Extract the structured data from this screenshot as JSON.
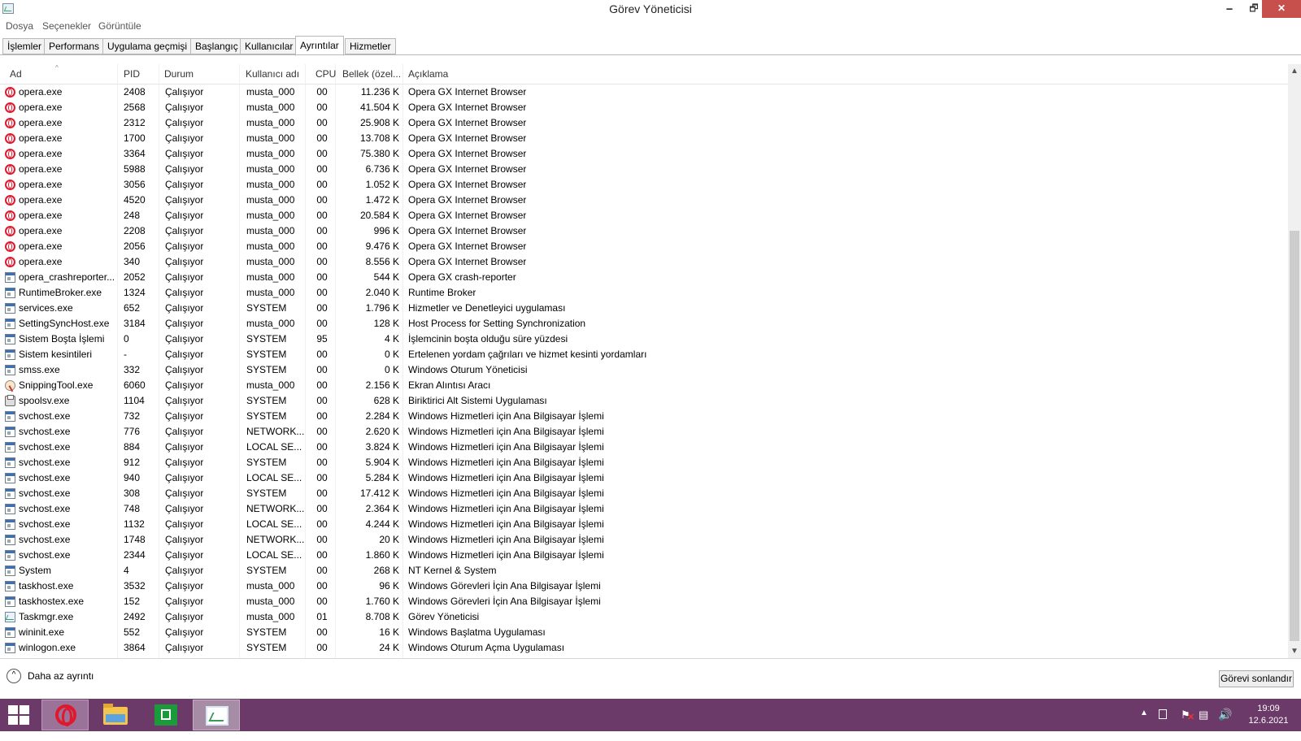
{
  "window": {
    "title": "Görev Yöneticisi",
    "min_glyph": "🗕",
    "max_glyph": "🗗",
    "close_glyph": "✕"
  },
  "menu": [
    "Dosya",
    "Seçenekler",
    "Görüntüle"
  ],
  "tabs": [
    {
      "label": "İşlemler",
      "active": false
    },
    {
      "label": "Performans",
      "active": false
    },
    {
      "label": "Uygulama geçmişi",
      "active": false
    },
    {
      "label": "Başlangıç",
      "active": false
    },
    {
      "label": "Kullanıcılar",
      "active": false
    },
    {
      "label": "Ayrıntılar",
      "active": true
    },
    {
      "label": "Hizmetler",
      "active": false
    }
  ],
  "columns": {
    "name": "Ad",
    "pid": "PID",
    "status": "Durum",
    "user": "Kullanıcı adı",
    "cpu": "CPU",
    "memory": "Bellek (özel...",
    "description": "Açıklama"
  },
  "rows": [
    {
      "icon": "opera",
      "name": "opera.exe",
      "pid": "2408",
      "status": "Çalışıyor",
      "user": "musta_000",
      "cpu": "00",
      "mem": "11.236 K",
      "desc": "Opera GX Internet Browser"
    },
    {
      "icon": "opera",
      "name": "opera.exe",
      "pid": "2568",
      "status": "Çalışıyor",
      "user": "musta_000",
      "cpu": "00",
      "mem": "41.504 K",
      "desc": "Opera GX Internet Browser"
    },
    {
      "icon": "opera",
      "name": "opera.exe",
      "pid": "2312",
      "status": "Çalışıyor",
      "user": "musta_000",
      "cpu": "00",
      "mem": "25.908 K",
      "desc": "Opera GX Internet Browser"
    },
    {
      "icon": "opera",
      "name": "opera.exe",
      "pid": "1700",
      "status": "Çalışıyor",
      "user": "musta_000",
      "cpu": "00",
      "mem": "13.708 K",
      "desc": "Opera GX Internet Browser"
    },
    {
      "icon": "opera",
      "name": "opera.exe",
      "pid": "3364",
      "status": "Çalışıyor",
      "user": "musta_000",
      "cpu": "00",
      "mem": "75.380 K",
      "desc": "Opera GX Internet Browser"
    },
    {
      "icon": "opera",
      "name": "opera.exe",
      "pid": "5988",
      "status": "Çalışıyor",
      "user": "musta_000",
      "cpu": "00",
      "mem": "6.736 K",
      "desc": "Opera GX Internet Browser"
    },
    {
      "icon": "opera",
      "name": "opera.exe",
      "pid": "3056",
      "status": "Çalışıyor",
      "user": "musta_000",
      "cpu": "00",
      "mem": "1.052 K",
      "desc": "Opera GX Internet Browser"
    },
    {
      "icon": "opera",
      "name": "opera.exe",
      "pid": "4520",
      "status": "Çalışıyor",
      "user": "musta_000",
      "cpu": "00",
      "mem": "1.472 K",
      "desc": "Opera GX Internet Browser"
    },
    {
      "icon": "opera",
      "name": "opera.exe",
      "pid": "248",
      "status": "Çalışıyor",
      "user": "musta_000",
      "cpu": "00",
      "mem": "20.584 K",
      "desc": "Opera GX Internet Browser"
    },
    {
      "icon": "opera",
      "name": "opera.exe",
      "pid": "2208",
      "status": "Çalışıyor",
      "user": "musta_000",
      "cpu": "00",
      "mem": "996 K",
      "desc": "Opera GX Internet Browser"
    },
    {
      "icon": "opera",
      "name": "opera.exe",
      "pid": "2056",
      "status": "Çalışıyor",
      "user": "musta_000",
      "cpu": "00",
      "mem": "9.476 K",
      "desc": "Opera GX Internet Browser"
    },
    {
      "icon": "opera",
      "name": "opera.exe",
      "pid": "340",
      "status": "Çalışıyor",
      "user": "musta_000",
      "cpu": "00",
      "mem": "8.556 K",
      "desc": "Opera GX Internet Browser"
    },
    {
      "icon": "exe",
      "name": "opera_crashreporter....",
      "pid": "2052",
      "status": "Çalışıyor",
      "user": "musta_000",
      "cpu": "00",
      "mem": "544 K",
      "desc": "Opera GX crash-reporter"
    },
    {
      "icon": "exe",
      "name": "RuntimeBroker.exe",
      "pid": "1324",
      "status": "Çalışıyor",
      "user": "musta_000",
      "cpu": "00",
      "mem": "2.040 K",
      "desc": "Runtime Broker"
    },
    {
      "icon": "exe",
      "name": "services.exe",
      "pid": "652",
      "status": "Çalışıyor",
      "user": "SYSTEM",
      "cpu": "00",
      "mem": "1.796 K",
      "desc": "Hizmetler ve Denetleyici uygulaması"
    },
    {
      "icon": "exe",
      "name": "SettingSyncHost.exe",
      "pid": "3184",
      "status": "Çalışıyor",
      "user": "musta_000",
      "cpu": "00",
      "mem": "128 K",
      "desc": "Host Process for Setting Synchronization"
    },
    {
      "icon": "exe",
      "name": "Sistem Boşta İşlemi",
      "pid": "0",
      "status": "Çalışıyor",
      "user": "SYSTEM",
      "cpu": "95",
      "mem": "4 K",
      "desc": "İşlemcinin boşta olduğu süre yüzdesi"
    },
    {
      "icon": "exe",
      "name": "Sistem kesintileri",
      "pid": "-",
      "status": "Çalışıyor",
      "user": "SYSTEM",
      "cpu": "00",
      "mem": "0 K",
      "desc": "Ertelenen yordam çağrıları ve hizmet kesinti yordamları"
    },
    {
      "icon": "exe",
      "name": "smss.exe",
      "pid": "332",
      "status": "Çalışıyor",
      "user": "SYSTEM",
      "cpu": "00",
      "mem": "0 K",
      "desc": "Windows Oturum Yöneticisi"
    },
    {
      "icon": "snip",
      "name": "SnippingTool.exe",
      "pid": "6060",
      "status": "Çalışıyor",
      "user": "musta_000",
      "cpu": "00",
      "mem": "2.156 K",
      "desc": "Ekran Alıntısı Aracı"
    },
    {
      "icon": "print",
      "name": "spoolsv.exe",
      "pid": "1104",
      "status": "Çalışıyor",
      "user": "SYSTEM",
      "cpu": "00",
      "mem": "628 K",
      "desc": "Biriktirici Alt Sistemi Uygulaması"
    },
    {
      "icon": "exe",
      "name": "svchost.exe",
      "pid": "732",
      "status": "Çalışıyor",
      "user": "SYSTEM",
      "cpu": "00",
      "mem": "2.284 K",
      "desc": "Windows Hizmetleri için Ana Bilgisayar İşlemi"
    },
    {
      "icon": "exe",
      "name": "svchost.exe",
      "pid": "776",
      "status": "Çalışıyor",
      "user": "NETWORK...",
      "cpu": "00",
      "mem": "2.620 K",
      "desc": "Windows Hizmetleri için Ana Bilgisayar İşlemi"
    },
    {
      "icon": "exe",
      "name": "svchost.exe",
      "pid": "884",
      "status": "Çalışıyor",
      "user": "LOCAL SE...",
      "cpu": "00",
      "mem": "3.824 K",
      "desc": "Windows Hizmetleri için Ana Bilgisayar İşlemi"
    },
    {
      "icon": "exe",
      "name": "svchost.exe",
      "pid": "912",
      "status": "Çalışıyor",
      "user": "SYSTEM",
      "cpu": "00",
      "mem": "5.904 K",
      "desc": "Windows Hizmetleri için Ana Bilgisayar İşlemi"
    },
    {
      "icon": "exe",
      "name": "svchost.exe",
      "pid": "940",
      "status": "Çalışıyor",
      "user": "LOCAL SE...",
      "cpu": "00",
      "mem": "5.284 K",
      "desc": "Windows Hizmetleri için Ana Bilgisayar İşlemi"
    },
    {
      "icon": "exe",
      "name": "svchost.exe",
      "pid": "308",
      "status": "Çalışıyor",
      "user": "SYSTEM",
      "cpu": "00",
      "mem": "17.412 K",
      "desc": "Windows Hizmetleri için Ana Bilgisayar İşlemi"
    },
    {
      "icon": "exe",
      "name": "svchost.exe",
      "pid": "748",
      "status": "Çalışıyor",
      "user": "NETWORK...",
      "cpu": "00",
      "mem": "2.364 K",
      "desc": "Windows Hizmetleri için Ana Bilgisayar İşlemi"
    },
    {
      "icon": "exe",
      "name": "svchost.exe",
      "pid": "1132",
      "status": "Çalışıyor",
      "user": "LOCAL SE...",
      "cpu": "00",
      "mem": "4.244 K",
      "desc": "Windows Hizmetleri için Ana Bilgisayar İşlemi"
    },
    {
      "icon": "exe",
      "name": "svchost.exe",
      "pid": "1748",
      "status": "Çalışıyor",
      "user": "NETWORK...",
      "cpu": "00",
      "mem": "20 K",
      "desc": "Windows Hizmetleri için Ana Bilgisayar İşlemi"
    },
    {
      "icon": "exe",
      "name": "svchost.exe",
      "pid": "2344",
      "status": "Çalışıyor",
      "user": "LOCAL SE...",
      "cpu": "00",
      "mem": "1.860 K",
      "desc": "Windows Hizmetleri için Ana Bilgisayar İşlemi"
    },
    {
      "icon": "exe",
      "name": "System",
      "pid": "4",
      "status": "Çalışıyor",
      "user": "SYSTEM",
      "cpu": "00",
      "mem": "268 K",
      "desc": "NT Kernel & System"
    },
    {
      "icon": "exe",
      "name": "taskhost.exe",
      "pid": "3532",
      "status": "Çalışıyor",
      "user": "musta_000",
      "cpu": "00",
      "mem": "96 K",
      "desc": "Windows Görevleri İçin Ana Bilgisayar İşlemi"
    },
    {
      "icon": "exe",
      "name": "taskhostex.exe",
      "pid": "152",
      "status": "Çalışıyor",
      "user": "musta_000",
      "cpu": "00",
      "mem": "1.760 K",
      "desc": "Windows Görevleri İçin Ana Bilgisayar İşlemi"
    },
    {
      "icon": "tm",
      "name": "Taskmgr.exe",
      "pid": "2492",
      "status": "Çalışıyor",
      "user": "musta_000",
      "cpu": "01",
      "mem": "8.708 K",
      "desc": "Görev Yöneticisi"
    },
    {
      "icon": "exe",
      "name": "wininit.exe",
      "pid": "552",
      "status": "Çalışıyor",
      "user": "SYSTEM",
      "cpu": "00",
      "mem": "16 K",
      "desc": "Windows Başlatma Uygulaması"
    },
    {
      "icon": "exe",
      "name": "winlogon.exe",
      "pid": "3864",
      "status": "Çalışıyor",
      "user": "SYSTEM",
      "cpu": "00",
      "mem": "24 K",
      "desc": "Windows Oturum Açma Uygulaması"
    }
  ],
  "footer": {
    "less_details": "Daha az ayrıntı",
    "end_task": "Görevi sonlandır",
    "less_icon": "chevron-up-icon"
  },
  "taskbar": {
    "items": [
      "start-icon",
      "opera-icon",
      "file-explorer-icon",
      "store-icon",
      "task-manager-icon"
    ],
    "time": "19:09",
    "date": "12.6.2021"
  },
  "colors": {
    "taskbar": "#6b3a68",
    "close_button": "#c7504c",
    "opera_red": "#e0182d"
  }
}
